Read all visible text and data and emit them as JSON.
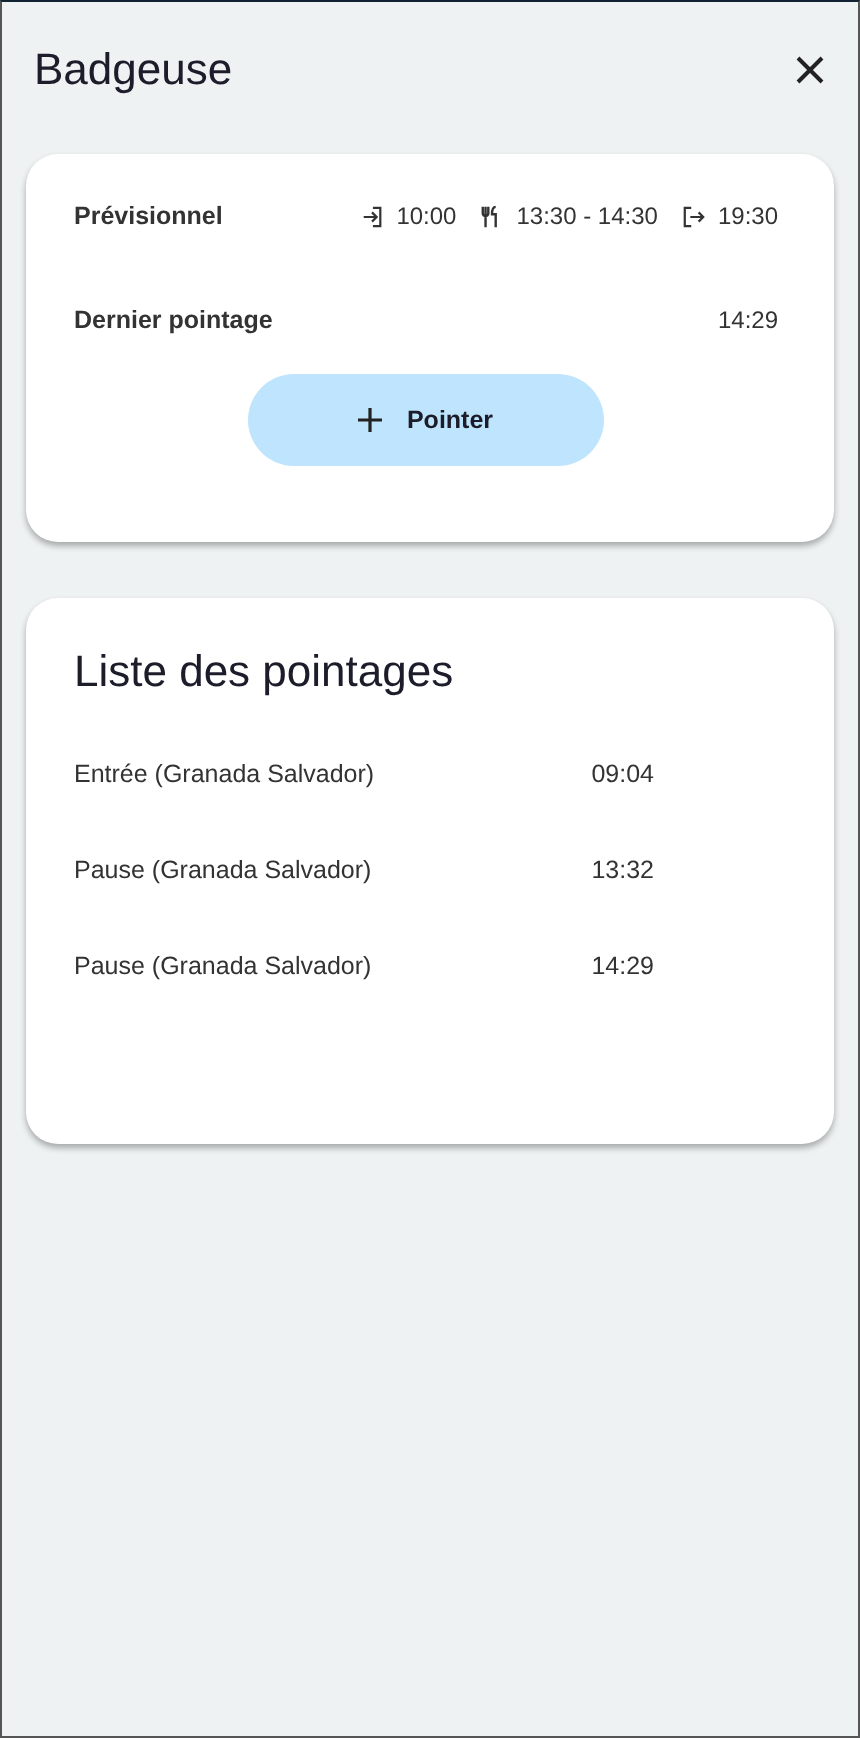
{
  "header": {
    "title": "Badgeuse"
  },
  "summary": {
    "forecast_label": "Prévisionnel",
    "forecast": [
      {
        "kind": "in",
        "time": "10:00"
      },
      {
        "kind": "meal",
        "time": "13:30 - 14:30"
      },
      {
        "kind": "out",
        "time": "19:30"
      }
    ],
    "last_label": "Dernier pointage",
    "last_time": "14:29",
    "button": "Pointer"
  },
  "list": {
    "title": "Liste des pointages",
    "rows": [
      {
        "label": "Entrée (Granada Salvador)",
        "time": "09:04"
      },
      {
        "label": "Pause (Granada Salvador)",
        "time": "13:32"
      },
      {
        "label": "Pause (Granada Salvador)",
        "time": "14:29"
      }
    ]
  }
}
